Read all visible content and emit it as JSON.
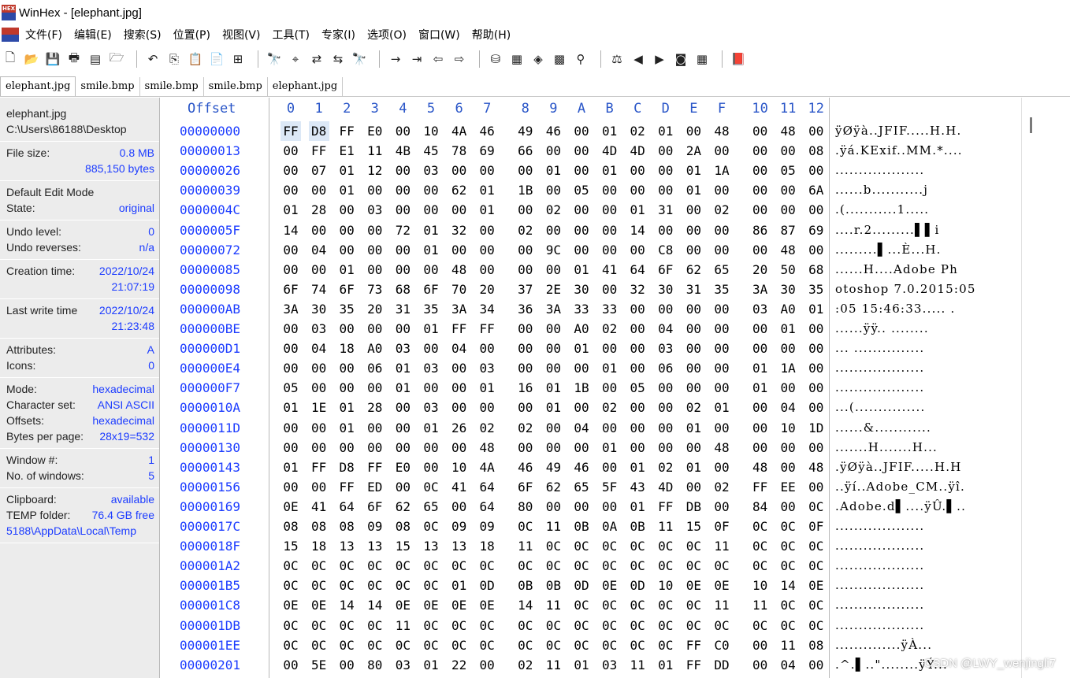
{
  "window": {
    "title": "WinHex - [elephant.jpg]"
  },
  "menu": [
    "文件(F)",
    "编辑(E)",
    "搜索(S)",
    "位置(P)",
    "视图(V)",
    "工具(T)",
    "专家(I)",
    "选项(O)",
    "窗口(W)",
    "帮助(H)"
  ],
  "tabs": [
    "elephant.jpg",
    "smile.bmp",
    "smile.bmp",
    "smile.bmp",
    "elephant.jpg"
  ],
  "info": {
    "file_name": "elephant.jpg",
    "file_path": "C:\\Users\\86188\\Desktop",
    "file_size_label": "File size:",
    "file_size_mb": "0.8 MB",
    "file_size_bytes": "885,150 bytes",
    "edit_mode_label": "Default Edit Mode",
    "state_label": "State:",
    "state_value": "original",
    "undo_level_label": "Undo level:",
    "undo_level_value": "0",
    "undo_reverses_label": "Undo reverses:",
    "undo_reverses_value": "n/a",
    "creation_label": "Creation time:",
    "creation_date": "2022/10/24",
    "creation_time": "21:07:19",
    "lastwrite_label": "Last write time",
    "lastwrite_date": "2022/10/24",
    "lastwrite_time": "21:23:48",
    "attributes_label": "Attributes:",
    "attributes_value": "A",
    "icons_label": "Icons:",
    "icons_value": "0",
    "mode_label": "Mode:",
    "mode_value": "hexadecimal",
    "charset_label": "Character set:",
    "charset_value": "ANSI ASCII",
    "offsets_label": "Offsets:",
    "offsets_value": "hexadecimal",
    "bpp_label": "Bytes per page:",
    "bpp_value": "28x19=532",
    "window_label": "Window #:",
    "window_value": "1",
    "nwin_label": "No. of windows:",
    "nwin_value": "5",
    "clipboard_label": "Clipboard:",
    "clipboard_value": "available",
    "temp_label": "TEMP folder:",
    "temp_value": "76.4 GB free",
    "temp_path": "5188\\AppData\\Local\\Temp"
  },
  "hex": {
    "offset_header": "Offset",
    "columns": [
      "0",
      "1",
      "2",
      "3",
      "4",
      "5",
      "6",
      "7",
      "8",
      "9",
      "A",
      "B",
      "C",
      "D",
      "E",
      "F",
      "10",
      "11",
      "12"
    ],
    "rows": [
      {
        "offset": "00000000",
        "bytes": [
          "FF",
          "D8",
          "FF",
          "E0",
          "00",
          "10",
          "4A",
          "46",
          "49",
          "46",
          "00",
          "01",
          "02",
          "01",
          "00",
          "48",
          "00",
          "48",
          "00"
        ],
        "text": "ÿØÿà..JFIF.....H.H."
      },
      {
        "offset": "00000013",
        "bytes": [
          "00",
          "FF",
          "E1",
          "11",
          "4B",
          "45",
          "78",
          "69",
          "66",
          "00",
          "00",
          "4D",
          "4D",
          "00",
          "2A",
          "00",
          "00",
          "00",
          "08"
        ],
        "text": ".ÿá.KExif..MM.*...."
      },
      {
        "offset": "00000026",
        "bytes": [
          "00",
          "07",
          "01",
          "12",
          "00",
          "03",
          "00",
          "00",
          "00",
          "01",
          "00",
          "01",
          "00",
          "00",
          "01",
          "1A",
          "00",
          "05",
          "00"
        ],
        "text": "..................."
      },
      {
        "offset": "00000039",
        "bytes": [
          "00",
          "00",
          "01",
          "00",
          "00",
          "00",
          "62",
          "01",
          "1B",
          "00",
          "05",
          "00",
          "00",
          "00",
          "01",
          "00",
          "00",
          "00",
          "6A"
        ],
        "text": "......b...........j"
      },
      {
        "offset": "0000004C",
        "bytes": [
          "01",
          "28",
          "00",
          "03",
          "00",
          "00",
          "00",
          "01",
          "00",
          "02",
          "00",
          "00",
          "01",
          "31",
          "00",
          "02",
          "00",
          "00",
          "00"
        ],
        "text": ".(...........1....."
      },
      {
        "offset": "0000005F",
        "bytes": [
          "14",
          "00",
          "00",
          "00",
          "72",
          "01",
          "32",
          "00",
          "02",
          "00",
          "00",
          "00",
          "14",
          "00",
          "00",
          "00",
          "86",
          "87",
          "69"
        ],
        "text": "....r.2.........▌▌i"
      },
      {
        "offset": "00000072",
        "bytes": [
          "00",
          "04",
          "00",
          "00",
          "00",
          "01",
          "00",
          "00",
          "00",
          "9C",
          "00",
          "00",
          "00",
          "C8",
          "00",
          "00",
          "00",
          "48",
          "00"
        ],
        "text": ".........▌...È...H."
      },
      {
        "offset": "00000085",
        "bytes": [
          "00",
          "00",
          "01",
          "00",
          "00",
          "00",
          "48",
          "00",
          "00",
          "00",
          "01",
          "41",
          "64",
          "6F",
          "62",
          "65",
          "20",
          "50",
          "68"
        ],
        "text": "......H....Adobe Ph"
      },
      {
        "offset": "00000098",
        "bytes": [
          "6F",
          "74",
          "6F",
          "73",
          "68",
          "6F",
          "70",
          "20",
          "37",
          "2E",
          "30",
          "00",
          "32",
          "30",
          "31",
          "35",
          "3A",
          "30",
          "35"
        ],
        "text": "otoshop 7.0.2015:05"
      },
      {
        "offset": "000000AB",
        "bytes": [
          "3A",
          "30",
          "35",
          "20",
          "31",
          "35",
          "3A",
          "34",
          "36",
          "3A",
          "33",
          "33",
          "00",
          "00",
          "00",
          "00",
          "03",
          "A0",
          "01"
        ],
        "text": ":05 15:46:33..... ."
      },
      {
        "offset": "000000BE",
        "bytes": [
          "00",
          "03",
          "00",
          "00",
          "00",
          "01",
          "FF",
          "FF",
          "00",
          "00",
          "A0",
          "02",
          "00",
          "04",
          "00",
          "00",
          "00",
          "01",
          "00"
        ],
        "text": "......ÿÿ.. ........"
      },
      {
        "offset": "000000D1",
        "bytes": [
          "00",
          "04",
          "18",
          "A0",
          "03",
          "00",
          "04",
          "00",
          "00",
          "00",
          "01",
          "00",
          "00",
          "03",
          "00",
          "00",
          "00",
          "00",
          "00"
        ],
        "text": "... ..............."
      },
      {
        "offset": "000000E4",
        "bytes": [
          "00",
          "00",
          "00",
          "06",
          "01",
          "03",
          "00",
          "03",
          "00",
          "00",
          "00",
          "01",
          "00",
          "06",
          "00",
          "00",
          "01",
          "1A",
          "00"
        ],
        "text": "..................."
      },
      {
        "offset": "000000F7",
        "bytes": [
          "05",
          "00",
          "00",
          "00",
          "01",
          "00",
          "00",
          "01",
          "16",
          "01",
          "1B",
          "00",
          "05",
          "00",
          "00",
          "00",
          "01",
          "00",
          "00"
        ],
        "text": "..................."
      },
      {
        "offset": "0000010A",
        "bytes": [
          "01",
          "1E",
          "01",
          "28",
          "00",
          "03",
          "00",
          "00",
          "00",
          "01",
          "00",
          "02",
          "00",
          "00",
          "02",
          "01",
          "00",
          "04",
          "00"
        ],
        "text": "...(..............."
      },
      {
        "offset": "0000011D",
        "bytes": [
          "00",
          "00",
          "01",
          "00",
          "00",
          "01",
          "26",
          "02",
          "02",
          "00",
          "04",
          "00",
          "00",
          "00",
          "01",
          "00",
          "00",
          "10",
          "1D"
        ],
        "text": "......&............"
      },
      {
        "offset": "00000130",
        "bytes": [
          "00",
          "00",
          "00",
          "00",
          "00",
          "00",
          "00",
          "48",
          "00",
          "00",
          "00",
          "01",
          "00",
          "00",
          "00",
          "48",
          "00",
          "00",
          "00"
        ],
        "text": ".......H.......H..."
      },
      {
        "offset": "00000143",
        "bytes": [
          "01",
          "FF",
          "D8",
          "FF",
          "E0",
          "00",
          "10",
          "4A",
          "46",
          "49",
          "46",
          "00",
          "01",
          "02",
          "01",
          "00",
          "48",
          "00",
          "48"
        ],
        "text": ".ÿØÿà..JFIF.....H.H"
      },
      {
        "offset": "00000156",
        "bytes": [
          "00",
          "00",
          "FF",
          "ED",
          "00",
          "0C",
          "41",
          "64",
          "6F",
          "62",
          "65",
          "5F",
          "43",
          "4D",
          "00",
          "02",
          "FF",
          "EE",
          "00"
        ],
        "text": "..ÿí..Adobe_CM..ÿî."
      },
      {
        "offset": "00000169",
        "bytes": [
          "0E",
          "41",
          "64",
          "6F",
          "62",
          "65",
          "00",
          "64",
          "80",
          "00",
          "00",
          "00",
          "01",
          "FF",
          "DB",
          "00",
          "84",
          "00",
          "0C"
        ],
        "text": ".Adobe.d▌....ÿÛ.▌.."
      },
      {
        "offset": "0000017C",
        "bytes": [
          "08",
          "08",
          "08",
          "09",
          "08",
          "0C",
          "09",
          "09",
          "0C",
          "11",
          "0B",
          "0A",
          "0B",
          "11",
          "15",
          "0F",
          "0C",
          "0C",
          "0F"
        ],
        "text": "..................."
      },
      {
        "offset": "0000018F",
        "bytes": [
          "15",
          "18",
          "13",
          "13",
          "15",
          "13",
          "13",
          "18",
          "11",
          "0C",
          "0C",
          "0C",
          "0C",
          "0C",
          "0C",
          "11",
          "0C",
          "0C",
          "0C"
        ],
        "text": "..................."
      },
      {
        "offset": "000001A2",
        "bytes": [
          "0C",
          "0C",
          "0C",
          "0C",
          "0C",
          "0C",
          "0C",
          "0C",
          "0C",
          "0C",
          "0C",
          "0C",
          "0C",
          "0C",
          "0C",
          "0C",
          "0C",
          "0C",
          "0C"
        ],
        "text": "..................."
      },
      {
        "offset": "000001B5",
        "bytes": [
          "0C",
          "0C",
          "0C",
          "0C",
          "0C",
          "0C",
          "01",
          "0D",
          "0B",
          "0B",
          "0D",
          "0E",
          "0D",
          "10",
          "0E",
          "0E",
          "10",
          "14",
          "0E"
        ],
        "text": "..................."
      },
      {
        "offset": "000001C8",
        "bytes": [
          "0E",
          "0E",
          "14",
          "14",
          "0E",
          "0E",
          "0E",
          "0E",
          "14",
          "11",
          "0C",
          "0C",
          "0C",
          "0C",
          "0C",
          "11",
          "11",
          "0C",
          "0C"
        ],
        "text": "..................."
      },
      {
        "offset": "000001DB",
        "bytes": [
          "0C",
          "0C",
          "0C",
          "0C",
          "11",
          "0C",
          "0C",
          "0C",
          "0C",
          "0C",
          "0C",
          "0C",
          "0C",
          "0C",
          "0C",
          "0C",
          "0C",
          "0C",
          "0C"
        ],
        "text": "..................."
      },
      {
        "offset": "000001EE",
        "bytes": [
          "0C",
          "0C",
          "0C",
          "0C",
          "0C",
          "0C",
          "0C",
          "0C",
          "0C",
          "0C",
          "0C",
          "0C",
          "0C",
          "0C",
          "FF",
          "C0",
          "00",
          "11",
          "08"
        ],
        "text": "..............ÿÀ..."
      },
      {
        "offset": "00000201",
        "bytes": [
          "00",
          "5E",
          "00",
          "80",
          "03",
          "01",
          "22",
          "00",
          "02",
          "11",
          "01",
          "03",
          "11",
          "01",
          "FF",
          "DD",
          "00",
          "04",
          "00"
        ],
        "text": ".^.▌..\"........ÿÝ..."
      }
    ]
  },
  "watermark": "CSDN @LWY_wenjingli7"
}
